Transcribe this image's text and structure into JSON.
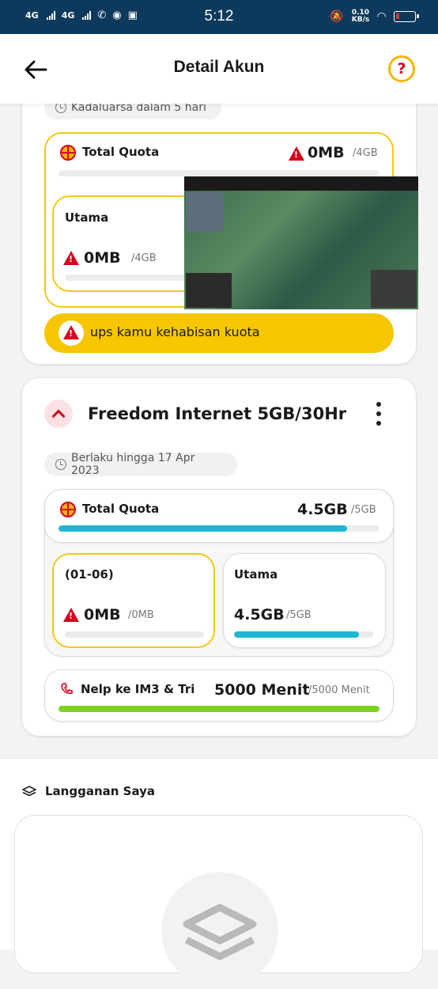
{
  "statusbar": {
    "net1": "4G",
    "net2": "4G",
    "time": "5:12",
    "speed_value": "0.10",
    "speed_unit": "KB/s"
  },
  "header": {
    "title": "Detail Akun",
    "help": "?"
  },
  "card1": {
    "expiry": "Kadaluarsa dalam 5 hari",
    "total_label": "Total Quota",
    "total_value": "0MB",
    "total_max": "/4GB",
    "total_fraction": 0,
    "utama_label": "Utama",
    "utama_value": "0MB",
    "utama_max": "/4GB",
    "utama_fraction": 0,
    "banner_text": "ups kamu kehabisan kuota"
  },
  "card2": {
    "name": "Freedom Internet 5GB/30Hr",
    "valid": "Berlaku hingga 17 Apr 2023",
    "total_label": "Total Quota",
    "total_value": "4.5GB",
    "total_max": "/5GB",
    "total_fraction": 0.9,
    "sub1_label": "(01-06)",
    "sub1_value": "0MB",
    "sub1_max": "/0MB",
    "sub1_fraction": 0,
    "sub2_label": "Utama",
    "sub2_value": "4.5GB",
    "sub2_max": "/5GB",
    "sub2_fraction": 0.9,
    "call_label": "Nelp ke IM3 & Tri",
    "call_value": "5000 Menit",
    "call_max": "/5000 Menit",
    "call_fraction": 1.0
  },
  "subscriptions": {
    "title": "Langganan Saya"
  },
  "colors": {
    "accent_red": "#d6001c",
    "accent_yellow": "#f7c600",
    "bar_cyan": "#1fb6d2",
    "bar_green": "#7ed321"
  }
}
